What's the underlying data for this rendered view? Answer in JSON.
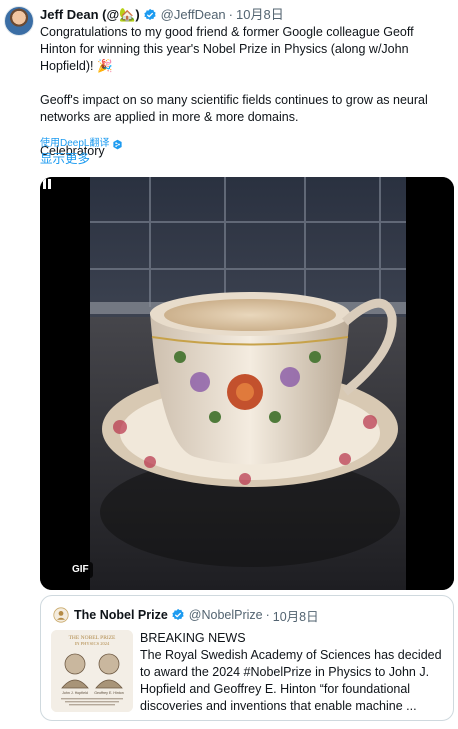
{
  "tweet": {
    "author_name": "Jeff Dean (@🏡)",
    "handle": "@JeffDean",
    "separator": "·",
    "time": "10月8日",
    "paragraphs": [
      "Congratulations to my good friend & former Google colleague Geoff Hinton for winning this year's Nobel Prize in Physics (along w/John Hopfield)! 🎉",
      "Geoff's impact on so many scientific fields continues to grow as neural networks are applied in more & more domains.",
      "Celebratory"
    ],
    "translate_label": "使用DeepL翻译",
    "show_more_label": "显示更多"
  },
  "media": {
    "gif_label": "GIF",
    "icon": "pause-icon"
  },
  "quoted": {
    "author_name": "The Nobel Prize",
    "handle": "@NobelPrize",
    "separator": "·",
    "time": "10月8日",
    "text_lines": [
      "BREAKING NEWS",
      "The Royal Swedish Academy of Sciences has decided to award the 2024 #NobelPrize in Physics to John J. Hopfield and Geoffrey E. Hinton “for foundational discoveries and inventions that enable machine ..."
    ],
    "thumbnail": {
      "heading": "THE NOBEL PRIZE",
      "subheading": "IN PHYSICS 2024",
      "name_left": "John J. Hopfield",
      "name_right": "Geoffrey E. Hinton"
    }
  },
  "colors": {
    "accent": "#1d9bf0",
    "verified": "#1d9bf0",
    "muted": "#536471",
    "border": "#cfd9de"
  }
}
